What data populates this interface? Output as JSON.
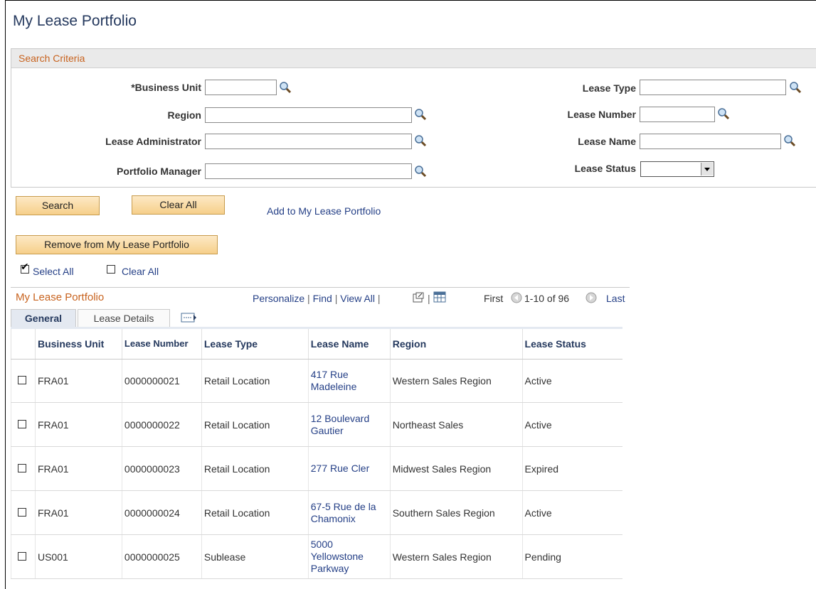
{
  "page_title": "My Lease Portfolio",
  "search": {
    "header": "Search Criteria",
    "business_unit_label": "*Business Unit",
    "region_label": "Region",
    "lease_admin_label": "Lease Administrator",
    "portfolio_manager_label": "Portfolio Manager",
    "lease_type_label": "Lease Type",
    "lease_number_label": "Lease Number",
    "lease_name_label": "Lease Name",
    "lease_status_label": "Lease Status",
    "business_unit_value": "",
    "region_value": "",
    "lease_admin_value": "",
    "portfolio_manager_value": "",
    "lease_type_value": "",
    "lease_number_value": "",
    "lease_name_value": "",
    "lease_status_value": ""
  },
  "actions": {
    "search": "Search",
    "clear_all": "Clear All",
    "add_link": "Add to My Lease Portfolio",
    "remove": "Remove from My Lease Portfolio",
    "select_all": "Select All",
    "clear_all_check": "Clear All"
  },
  "grid": {
    "title": "My Lease Portfolio",
    "personalize": "Personalize",
    "find": "Find",
    "view_all": "View All",
    "first": "First",
    "range": "1-10 of 96",
    "last": "Last",
    "tabs": [
      "General",
      "Lease Details"
    ],
    "columns": {
      "business_unit": "Business Unit",
      "lease_number": "Lease Number",
      "lease_type": "Lease Type",
      "lease_name": "Lease Name",
      "region": "Region",
      "lease_status": "Lease Status"
    },
    "rows": [
      {
        "bu": "FRA01",
        "num": "0000000021",
        "type": "Retail Location",
        "name": "417 Rue Madeleine",
        "region": "Western Sales Region",
        "status": "Active"
      },
      {
        "bu": "FRA01",
        "num": "0000000022",
        "type": "Retail Location",
        "name": "12 Boulevard Gautier",
        "region": "Northeast Sales",
        "status": "Active"
      },
      {
        "bu": "FRA01",
        "num": "0000000023",
        "type": "Retail Location",
        "name": "277 Rue Cler",
        "region": "Midwest Sales Region",
        "status": "Expired"
      },
      {
        "bu": "FRA01",
        "num": "0000000024",
        "type": "Retail Location",
        "name": "67-5 Rue de la Chamonix",
        "region": "Southern Sales Region",
        "status": "Active"
      },
      {
        "bu": "US001",
        "num": "0000000025",
        "type": "Sublease",
        "name": "5000 Yellowstone Parkway",
        "region": "Western Sales Region",
        "status": "Pending"
      }
    ]
  },
  "colors": {
    "title_blue": "#25395e",
    "header_orange": "#c8631f",
    "link_blue": "#243f86",
    "button_fill": "#f6cf8a"
  },
  "icons": [
    "lookup-icon",
    "new-window-icon",
    "spreadsheet-icon",
    "previous-icon",
    "next-icon",
    "show-all-columns-icon"
  ]
}
